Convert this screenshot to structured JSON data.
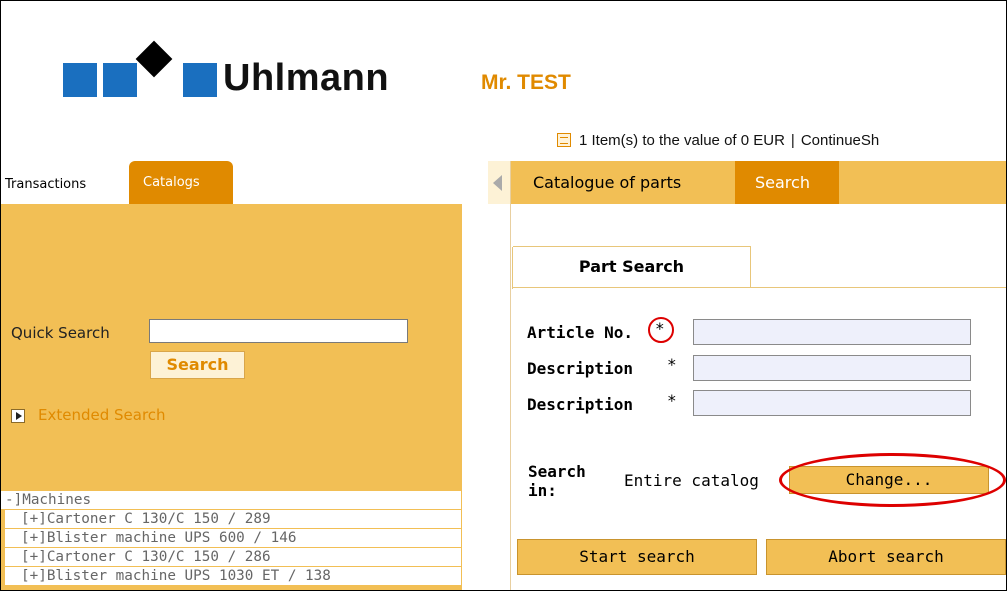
{
  "header": {
    "brand": "Uhlmann",
    "user": "Mr. TEST",
    "cart_summary": "1 Item(s) to the value of 0 EUR",
    "cart_separator": "|",
    "continue_link": "ContinueSh",
    "brand_color": "#1a6fbf",
    "accent_color": "#e08a00"
  },
  "left_tabs": {
    "transactions": "Transactions",
    "catalogs": "Catalogs"
  },
  "quick_search": {
    "label": "Quick Search",
    "value": "",
    "button": "Search"
  },
  "extended_search": "Extended Search",
  "tree": {
    "root": "-]Machines",
    "items": [
      "[+]Cartoner C 130/C 150 / 289",
      "[+]Blister machine UPS 600 / 146",
      "[+]Cartoner C 130/C 150 / 286",
      "[+]Blister machine UPS 1030 ET / 138"
    ]
  },
  "right_tabs": {
    "catalogue": "Catalogue of parts",
    "search": "Search"
  },
  "part_search": {
    "tab_title": "Part Search",
    "fields": [
      {
        "label": "Article No.",
        "required_marker": "*",
        "value": ""
      },
      {
        "label": "Description",
        "required_marker": "*",
        "value": ""
      },
      {
        "label": "Description",
        "required_marker": "*",
        "value": ""
      }
    ],
    "search_in_label": "Search in:",
    "search_in_value": "Entire catalog",
    "change_button": "Change...",
    "start_button": "Start search",
    "abort_button": "Abort search"
  }
}
